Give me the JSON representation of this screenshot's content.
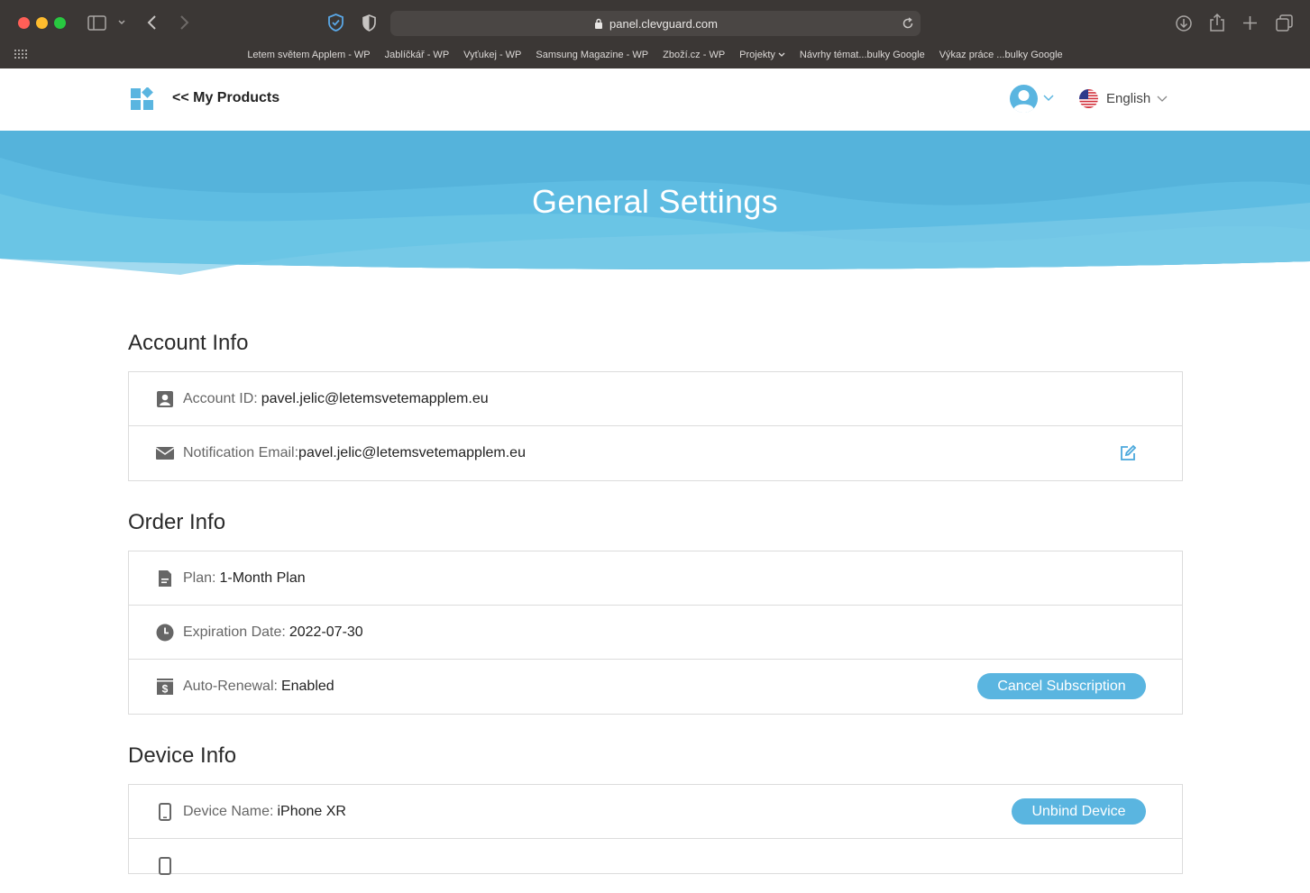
{
  "browser": {
    "url": "panel.clevguard.com",
    "bookmarks": [
      "Letem světem Applem - WP",
      "Jablíčkář - WP",
      "Vyťukej - WP",
      "Samsung Magazine - WP",
      "Zboží.cz - WP",
      "Projekty",
      "Návrhy témat...bulky Google",
      "Výkaz práce ...bulky Google"
    ]
  },
  "header": {
    "back_link": "<< My Products",
    "language": "English"
  },
  "banner": {
    "title": "General Settings"
  },
  "account": {
    "title": "Account Info",
    "id_label": "Account ID:",
    "id_value": "pavel.jelic@letemsvetemapplem.eu",
    "email_label": "Notification Email:",
    "email_value": "pavel.jelic@letemsvetemapplem.eu"
  },
  "order": {
    "title": "Order Info",
    "plan_label": "Plan:",
    "plan_value": "1-Month Plan",
    "expiration_label": "Expiration Date:",
    "expiration_value": "2022-07-30",
    "renewal_label": "Auto-Renewal:",
    "renewal_value": "Enabled",
    "cancel_button": "Cancel Subscription"
  },
  "device": {
    "title": "Device Info",
    "name_label": "Device Name:",
    "name_value": "iPhone XR",
    "unbind_button": "Unbind Device"
  },
  "colors": {
    "accent": "#5ab5e0",
    "banner": "#4fb0d8"
  }
}
